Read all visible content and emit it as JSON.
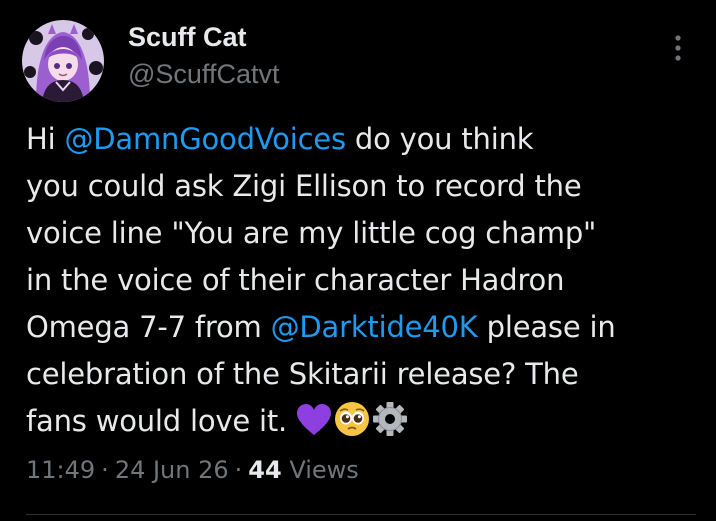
{
  "author": {
    "display_name": "Scuff Cat",
    "handle": "@ScuffCatvt"
  },
  "tweet": {
    "lines": [
      [
        {
          "text": "Hi "
        },
        {
          "text": "@DamnGoodVoices",
          "mention": true
        },
        {
          "text": " do you think"
        }
      ],
      [
        {
          "text": "you could ask Zigi Ellison to record the"
        }
      ],
      [
        {
          "text": "voice line \"You are my little cog champ\""
        }
      ],
      [
        {
          "text": "in the voice of their character Hadron"
        }
      ],
      [
        {
          "text": "Omega 7-7 from "
        },
        {
          "text": "@Darktide40K",
          "mention": true
        },
        {
          "text": " please in"
        }
      ],
      [
        {
          "text": "celebration of the Skitarii release? The"
        }
      ],
      [
        {
          "text": "fans would love it. "
        }
      ]
    ],
    "emojis": [
      "purple-heart-icon",
      "pleading-face-icon",
      "gear-icon"
    ]
  },
  "meta": {
    "time": "11:49",
    "date": "24 Jun 26",
    "separator": "·",
    "views_count": "44",
    "views_label": "Views"
  },
  "colors": {
    "background": "#000000",
    "text": "#e7e9ea",
    "secondary": "#71767b",
    "link": "#1d9bf0",
    "divider": "#2f3336"
  }
}
